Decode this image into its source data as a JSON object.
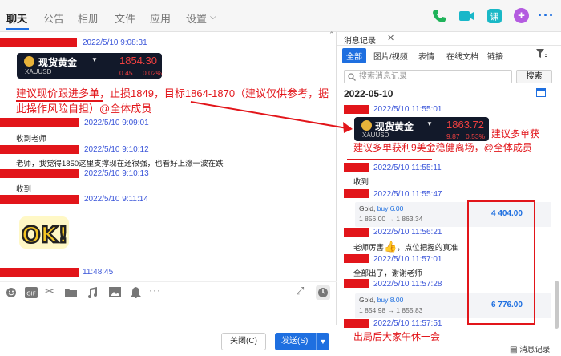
{
  "tabs": [
    "聊天",
    "公告",
    "相册",
    "文件",
    "应用",
    "设置"
  ],
  "top_icons": [
    "phone-icon",
    "video-icon",
    "lesson-icon",
    "add-icon",
    "more-icon"
  ],
  "left": {
    "messages": [
      {
        "time": "2022/5/10 9:08:31"
      },
      {
        "time": "2022/5/10 9:09:01",
        "text": "收到老师"
      },
      {
        "time": "2022/5/10 9:10:12",
        "text": "老师，我觉得1850这里支撑现在还很强，也看好上涨一波在跌"
      },
      {
        "time": "2022/5/10 9:10:13",
        "text": "收到"
      },
      {
        "time": "2022/5/10 9:11:14"
      },
      {
        "time": "11:48:45"
      }
    ],
    "gold_card": {
      "name": "现货黄金",
      "code": "XAUUSD",
      "price": "1854.30",
      "change": "0.45",
      "percent": "0.02%"
    },
    "annotation": "建议现价跟进多单，止损1849，目标1864-1870（建议仅供参考，据此操作风险自担）@全体成员",
    "sticker_text": "OK!",
    "close_label": "关闭(C)",
    "send_label": "发送(S)"
  },
  "right": {
    "title": "消息记录",
    "filters": [
      "全部",
      "图片/视频",
      "表情",
      "在线文档",
      "链接"
    ],
    "search_placeholder": "搜索消息记录",
    "search_button": "搜索",
    "date": "2022-05-10",
    "messages": [
      {
        "time": "2022/5/10 11:55:01"
      },
      {
        "time": "2022/5/10 11:55:11",
        "text": "收到"
      },
      {
        "time": "2022/5/10 11:55:47"
      },
      {
        "time": "2022/5/10 11:56:21",
        "text": "老师厉害",
        "text_after": "，点位把握的真准"
      },
      {
        "time": "2022/5/10 11:57:01",
        "text": "全部出了，谢谢老师"
      },
      {
        "time": "2022/5/10 11:57:28"
      },
      {
        "time": "2022/5/10 11:57:51"
      }
    ],
    "gold_card": {
      "name": "现货黄金",
      "code": "XAUUSD",
      "price": "1863.72",
      "change": "9.87",
      "percent": "0.53%"
    },
    "annotation": "建议多单获利9美金稳健离场，@全体成员",
    "trades": [
      {
        "symbol": "Gold,",
        "side": "buy 6.00",
        "prices": "1 856.00 → 1 863.34",
        "amount": "4 404.00"
      },
      {
        "symbol": "Gold,",
        "side": "buy 8.00",
        "prices": "1 854.98 → 1 855.83",
        "amount": "6 776.00"
      }
    ],
    "bottom_annotation": "出局后大家午休一会",
    "history_label": "消息记录"
  }
}
